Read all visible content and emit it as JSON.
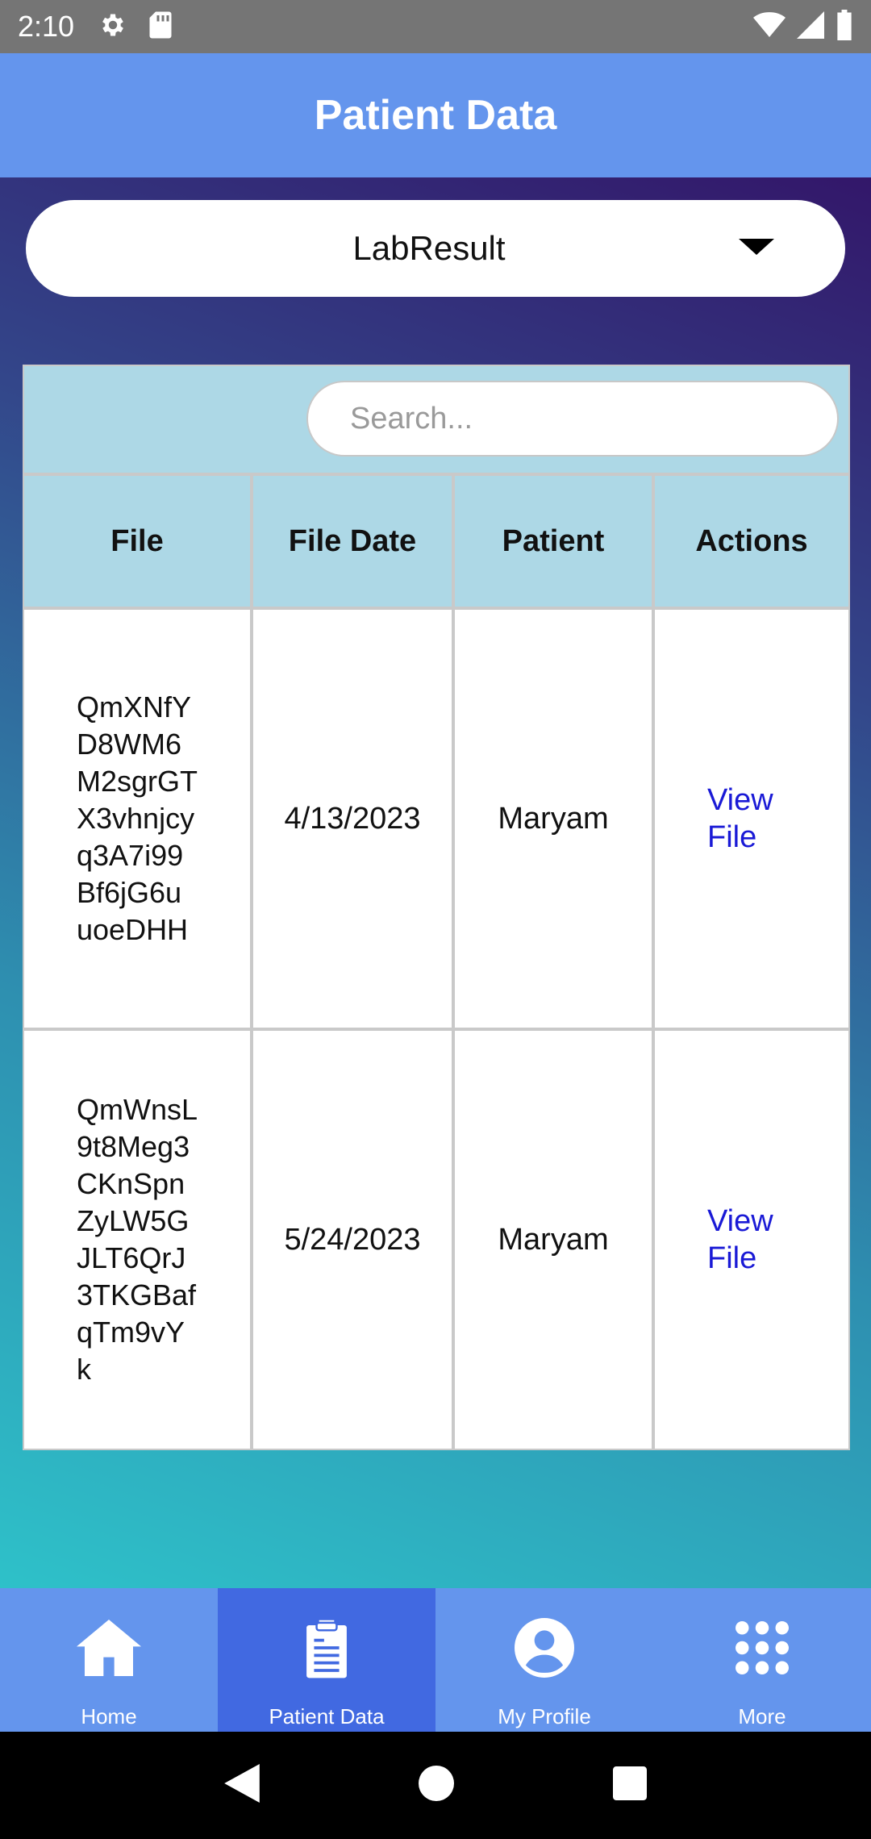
{
  "status_bar": {
    "time": "2:10",
    "icons": [
      "gear-icon",
      "sd-card-icon",
      "wifi-icon",
      "signal-icon",
      "battery-icon"
    ]
  },
  "header": {
    "title": "Patient Data"
  },
  "dropdown": {
    "selected": "LabResult"
  },
  "search": {
    "placeholder": "Search..."
  },
  "table": {
    "columns": [
      "File",
      "File Date",
      "Patient",
      "Actions"
    ],
    "rows": [
      {
        "file": "QmXNfYD8WM6M2sgrGTX3vhnjcyq3A7i99Bf6jG6uuoeDHH",
        "file_date": "4/13/2023",
        "patient": "Maryam",
        "action": "View File"
      },
      {
        "file": "QmWnsL9t8Meg3CKnSpnZyLW5GJLT6QrJ3TKGBafqTm9vYk",
        "file_date": "5/24/2023",
        "patient": "Maryam",
        "action": "View File"
      }
    ]
  },
  "bottom_nav": {
    "active": "Patient Data",
    "items": [
      {
        "label": "Home",
        "icon": "home-icon"
      },
      {
        "label": "Patient Data",
        "icon": "clipboard-icon"
      },
      {
        "label": "My Profile",
        "icon": "profile-icon"
      },
      {
        "label": "More",
        "icon": "grid-icon"
      }
    ]
  },
  "colors": {
    "header_bg": "#6495ED",
    "table_header_bg": "#ADD8E6",
    "nav_active_bg": "#4169E1",
    "link": "#1a1ad6"
  }
}
